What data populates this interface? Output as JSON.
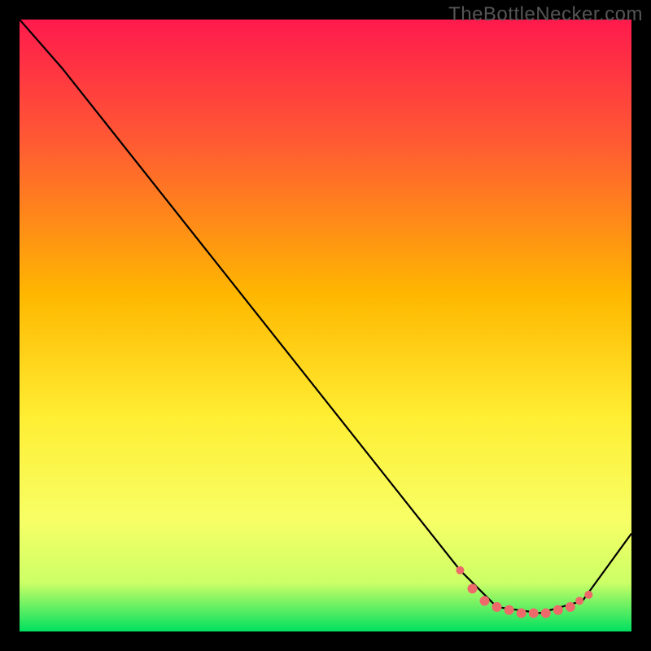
{
  "watermark": "TheBottleNecker.com",
  "chart_data": {
    "type": "line",
    "title": "",
    "xlabel": "",
    "ylabel": "",
    "xlim": [
      0,
      100
    ],
    "ylim": [
      0,
      100
    ],
    "gradient_stops": [
      {
        "offset": 0,
        "color": "#ff1a4d"
      },
      {
        "offset": 20,
        "color": "#ff5a33"
      },
      {
        "offset": 45,
        "color": "#ffb700"
      },
      {
        "offset": 65,
        "color": "#ffee33"
      },
      {
        "offset": 82,
        "color": "#f7ff66"
      },
      {
        "offset": 92,
        "color": "#ccff66"
      },
      {
        "offset": 100,
        "color": "#00e060"
      }
    ],
    "series": [
      {
        "name": "bottleneck-curve",
        "stroke": "#000000",
        "points": [
          {
            "x": 0,
            "y": 100
          },
          {
            "x": 7,
            "y": 92
          },
          {
            "x": 72,
            "y": 10
          },
          {
            "x": 78,
            "y": 4
          },
          {
            "x": 85,
            "y": 3
          },
          {
            "x": 92,
            "y": 5
          },
          {
            "x": 100,
            "y": 16
          }
        ]
      }
    ],
    "markers": {
      "color": "#ee6a6a",
      "points": [
        {
          "x": 72,
          "y": 10,
          "r": 5
        },
        {
          "x": 74,
          "y": 7,
          "r": 6
        },
        {
          "x": 76,
          "y": 5,
          "r": 6
        },
        {
          "x": 78,
          "y": 4,
          "r": 6
        },
        {
          "x": 80,
          "y": 3.5,
          "r": 6
        },
        {
          "x": 82,
          "y": 3,
          "r": 6
        },
        {
          "x": 84,
          "y": 3,
          "r": 6
        },
        {
          "x": 86,
          "y": 3,
          "r": 6
        },
        {
          "x": 88,
          "y": 3.5,
          "r": 6
        },
        {
          "x": 90,
          "y": 4,
          "r": 6
        },
        {
          "x": 91.5,
          "y": 5,
          "r": 5
        },
        {
          "x": 93,
          "y": 6,
          "r": 5
        }
      ]
    }
  }
}
